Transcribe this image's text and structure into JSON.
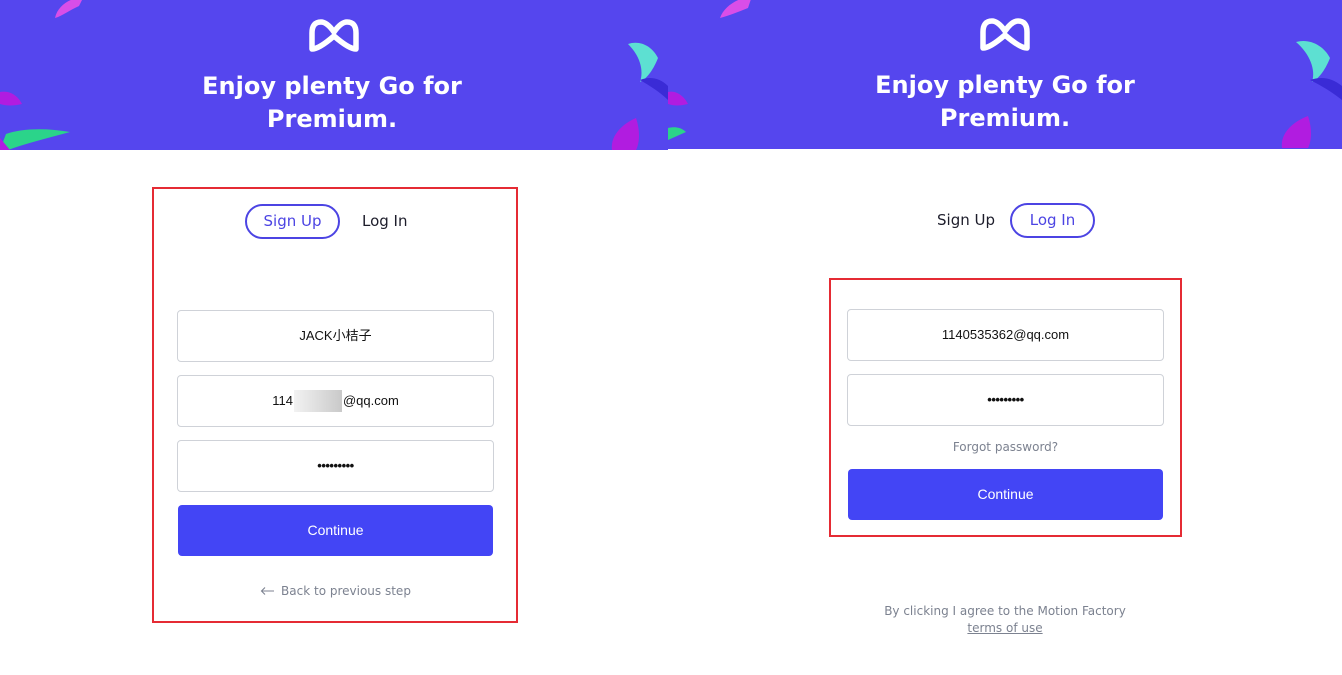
{
  "hero": {
    "headline_line1": "Enjoy plenty Go for",
    "headline_line2": "Premium.",
    "logo_icon": "motion-factory-logo-icon",
    "background": "#5546ee"
  },
  "signup_panel": {
    "tabs": {
      "signup": "Sign Up",
      "login": "Log In",
      "active": "signup"
    },
    "name_value": "JACK小桔子",
    "email_prefix": "114",
    "email_suffix": "@qq.com",
    "password_mask": "•••••••••",
    "continue_label": "Continue",
    "back_label": "Back to previous step",
    "back_icon": "arrow-left-icon"
  },
  "login_panel": {
    "tabs": {
      "signup": "Sign Up",
      "login": "Log In",
      "active": "login"
    },
    "email_value": "1140535362@qq.com",
    "password_mask": "•••••••••",
    "forgot_label": "Forgot password?",
    "continue_label": "Continue",
    "terms_line1": "By clicking I agree to the Motion Factory",
    "terms_link": "terms of use"
  },
  "colors": {
    "accent": "#4345f5",
    "tab_border": "#4c44e3",
    "highlight_frame": "#e52b34",
    "muted_text": "#7c8290"
  }
}
